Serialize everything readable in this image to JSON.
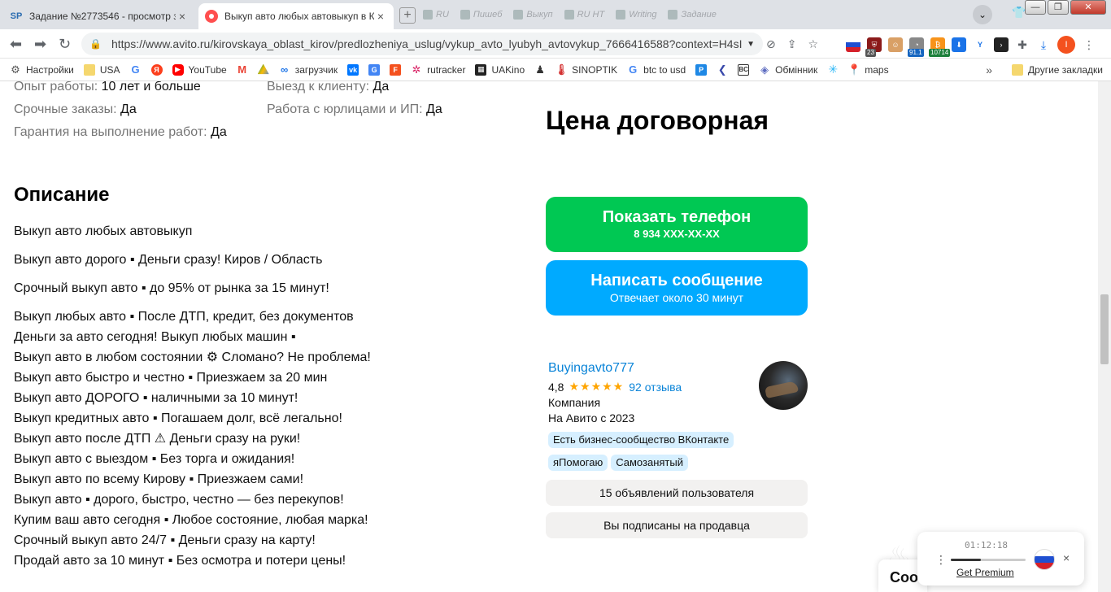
{
  "browser": {
    "tabs": [
      {
        "favicon": "SP",
        "title": "Задание №2773546 - просмотр з",
        "close": "×"
      },
      {
        "favicon": "avito",
        "title": "Выкуп авто любых автовыкуп в К",
        "close": "×"
      }
    ],
    "background_tabs": [
      "RU",
      "Пишеб",
      "Выкуп",
      "RU HT",
      "Writing",
      "Задание"
    ],
    "new_tab": "+",
    "url": "https://www.avito.ru/kirovskaya_oblast_kirov/predlozheniya_uslug/vykup_avto_lyubyh_avtovykup_7666416588?context=H4sIA...",
    "ext_badges": {
      "count_1": "23",
      "count_2": "91.1",
      "count_3": "10714"
    },
    "profile_initial": "I",
    "bookmarks": [
      "Настройки",
      "USA",
      "YouTube",
      "загрузчик",
      "rutracker",
      "UAKino",
      "SINOPTIK",
      "btc to usd",
      "Обмінник",
      "maps"
    ],
    "bookmarks_more": "»",
    "other_bookmarks": "Другие закладки"
  },
  "params": {
    "rows": [
      [
        {
          "label": "Опыт работы: ",
          "value": "10 лет и больше"
        },
        {
          "label": "Выезд к клиенту: ",
          "value": "Да"
        }
      ],
      [
        {
          "label": "Срочные заказы: ",
          "value": "Да"
        },
        {
          "label": "Работа с юрлицами и ИП: ",
          "value": "Да"
        }
      ],
      [
        {
          "label": "Гарантия на выполнение работ: ",
          "value": "Да"
        }
      ]
    ]
  },
  "description": {
    "title": "Описание",
    "lines": [
      "Выкуп авто любых автовыкуп",
      "Выкуп авто дорого ▪ Деньги сразу! Киров / Область",
      "Срочный выкуп авто ▪ до 95% от рынка за 15 минут!",
      "Выкуп любых авто ▪ После ДТП, кредит, без документов",
      "Деньги за авто сегодня! Выкуп любых машин ▪",
      "Выкуп авто в любом состоянии ⚙ Сломано? Не проблема!",
      "Выкуп авто быстро и честно ▪ Приезжаем за 20 мин",
      "Выкуп авто ДОРОГО ▪ наличными за 10 минут!",
      "Выкуп кредитных авто ▪ Погашаем долг, всё легально!",
      "Выкуп авто после ДТП ⚠ Деньги сразу на руки!",
      "Выкуп авто с выездом ▪ Без торга и ожидания!",
      "Выкуп авто по всему Кирову ▪ Приезжаем сами!",
      "Выкуп авто ▪ дорого, быстро, честно — без перекупов!",
      "Купим ваш авто сегодня ▪ Любое состояние, любая марка!",
      "Срочный выкуп авто 24/7 ▪ Деньги сразу на карту!",
      "Продай авто за 10 минут ▪ Без осмотра и потери цены!"
    ]
  },
  "sidebar": {
    "price": "Цена договорная",
    "phone_button": {
      "label": "Показать телефон",
      "sub": "8 934 XXX-XX-XX"
    },
    "message_button": {
      "label": "Написать сообщение",
      "sub": "Отвечает около 30 минут"
    },
    "seller": {
      "name": "Buyingavto777",
      "rating": "4,8",
      "stars": "★★★★★",
      "rating_value": 4.8,
      "reviews": "92 отзыва",
      "type": "Компания",
      "since": "На Авито с 2023",
      "badges": [
        "Есть бизнес-сообщество ВКонтакте",
        "яПомогаю",
        "Самозанятый"
      ]
    },
    "ads_button": "15 объявлений пользователя",
    "subscribe_button": "Вы подписаны на продавца"
  },
  "chat_stub": "Соо",
  "recorder": {
    "time": "01:12:18",
    "progress": 0.4,
    "link": "Get Premium",
    "close": "×"
  },
  "colors": {
    "phone_button": "#00c853",
    "message_button": "#00aaff",
    "link": "#0a84d8",
    "stars": "#ffa500"
  }
}
